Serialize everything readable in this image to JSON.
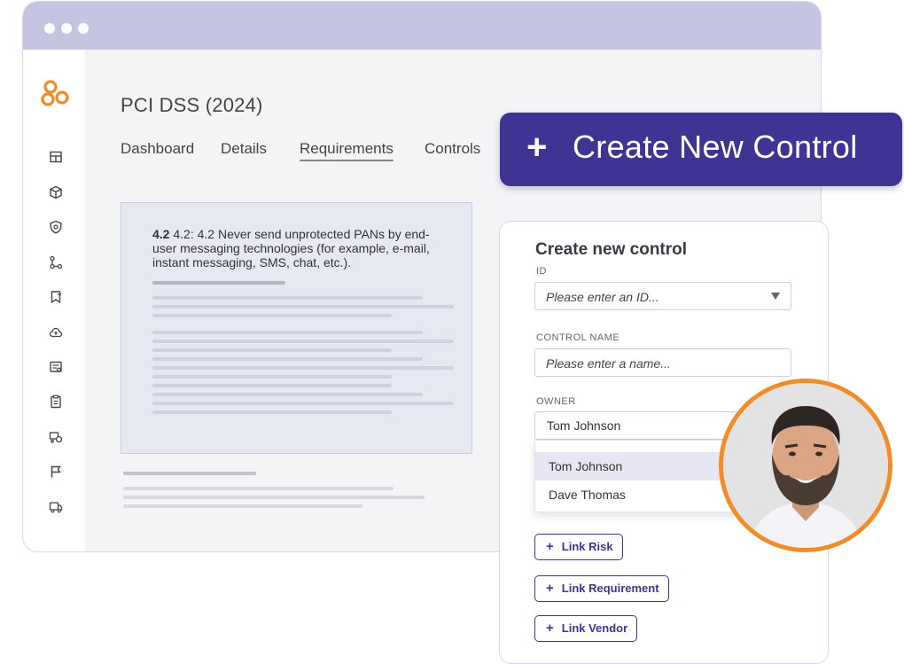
{
  "page": {
    "title": "PCI DSS (2024)",
    "tabs": [
      {
        "label": "Dashboard"
      },
      {
        "label": "Details"
      },
      {
        "label": "Requirements",
        "active": true
      },
      {
        "label": "Controls"
      }
    ]
  },
  "sidebar": {
    "icons": [
      "logo-icon",
      "dashboard-icon",
      "package-icon",
      "shield-icon",
      "workflow-icon",
      "bookmark-icon",
      "cloud-upload-icon",
      "report-icon",
      "clipboard-icon",
      "vendor-icon",
      "flag-icon",
      "truck-icon"
    ]
  },
  "requirement": {
    "number": "4.2",
    "text": "4.2: 4.2 Never send unprotected PANs by end-user messaging technologies (for example, e-mail, instant messaging, SMS, chat, etc.)."
  },
  "banner": {
    "plus": "+",
    "label": "Create New Control",
    "color": "#3f3494"
  },
  "form": {
    "title": "Create new control",
    "id_label": "ID",
    "id_placeholder": "Please enter an ID...",
    "name_label": "CONTROL NAME",
    "name_placeholder": "Please enter a name...",
    "owner_label": "OWNER",
    "owner_value": "Tom Johnson",
    "owner_options": [
      {
        "label": "Tom Johnson",
        "highlighted": true
      },
      {
        "label": "Dave Thomas",
        "highlighted": false
      }
    ],
    "buttons": [
      {
        "plus": "+",
        "label": "Link Risk"
      },
      {
        "plus": "+",
        "label": "Link Requirement"
      },
      {
        "plus": "+",
        "label": "Link Vendor"
      }
    ]
  },
  "colors": {
    "accent": "#3f3494",
    "titlebar": "#c5c5e2",
    "logo": "#f28c28",
    "avatar_ring": "#f28c28"
  }
}
